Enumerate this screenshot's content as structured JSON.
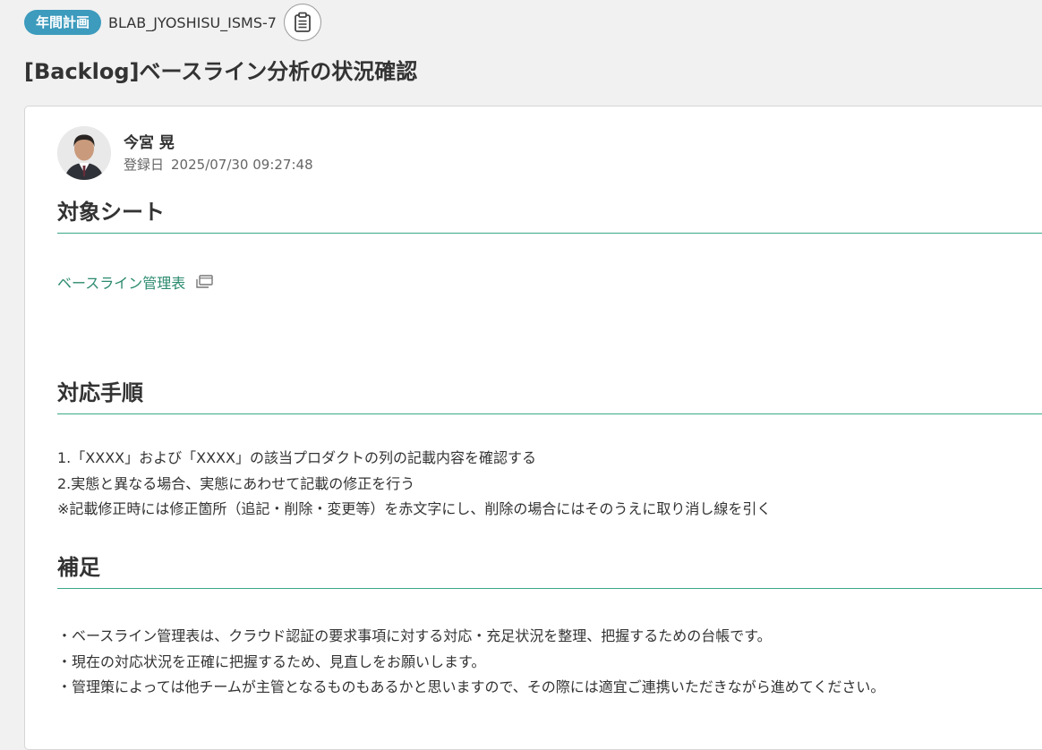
{
  "header": {
    "badge": "年間計画",
    "issue_key": "BLAB_JYOSHISU_ISMS-7",
    "copy_icon": "clipboard-icon"
  },
  "title": "[Backlog]ベースライン分析の状況確認",
  "author": {
    "name": "今宮 晃",
    "date_label": "登録日",
    "date": "2025/07/30 09:27:48"
  },
  "sections": {
    "sheet": {
      "heading": "対象シート",
      "link_text": "ベースライン管理表",
      "link_icon": "open-window-icon"
    },
    "steps": {
      "heading": "対応手順",
      "lines": [
        "1.「XXXX」および「XXXX」の該当プロダクトの列の記載内容を確認する",
        "2.実態と異なる場合、実態にあわせて記載の修正を行う",
        "※記載修正時には修正箇所（追記・削除・変更等）を赤文字にし、削除の場合にはそのうえに取り消し線を引く"
      ]
    },
    "note": {
      "heading": "補足",
      "lines": [
        "・ベースライン管理表は、クラウド認証の要求事項に対する対応・充足状況を整理、把握するための台帳です。",
        "・現在の対応状況を正確に把握するため、見直しをお願いします。",
        "・管理策によっては他チームが主管となるものもあるかと思いますので、その際には適宜ご連携いただきながら進めてください。"
      ]
    }
  },
  "colors": {
    "badge": "#3d9bbd",
    "accent_green": "#3aa886",
    "link": "#2b8a6e"
  }
}
